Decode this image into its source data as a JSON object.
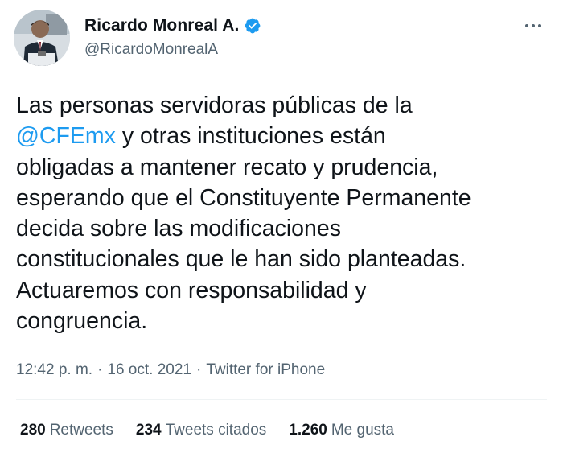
{
  "author": {
    "display_name": "Ricardo Monreal A.",
    "handle": "@RicardoMonrealA",
    "verified": true,
    "verified_icon": "verified-badge-icon",
    "verified_color": "#1d9bf0"
  },
  "menu": {
    "icon": "more-options-icon"
  },
  "tweet": {
    "lines": [
      {
        "text": "Las personas servidoras públicas de la"
      },
      {
        "mention": "@CFEmx",
        "text": " y otras instituciones están"
      },
      {
        "text": "obligadas a mantener recato y prudencia,"
      },
      {
        "text": "esperando que el Constituyente Permanente"
      },
      {
        "text": "decida sobre las modificaciones"
      },
      {
        "text": "constitucionales que le han sido planteadas."
      },
      {
        "text": "Actuaremos con responsabilidad y"
      },
      {
        "text": "congruencia."
      }
    ],
    "mention_color": "#1d9bf0"
  },
  "meta": {
    "time": "12:42 p. m.",
    "separator": "·",
    "date": "16 oct. 2021",
    "source": "Twitter for iPhone"
  },
  "stats": {
    "retweets": {
      "count": "280",
      "label": "Retweets"
    },
    "quotes": {
      "count": "234",
      "label": "Tweets citados"
    },
    "likes": {
      "count": "1.260",
      "label": "Me gusta"
    }
  }
}
